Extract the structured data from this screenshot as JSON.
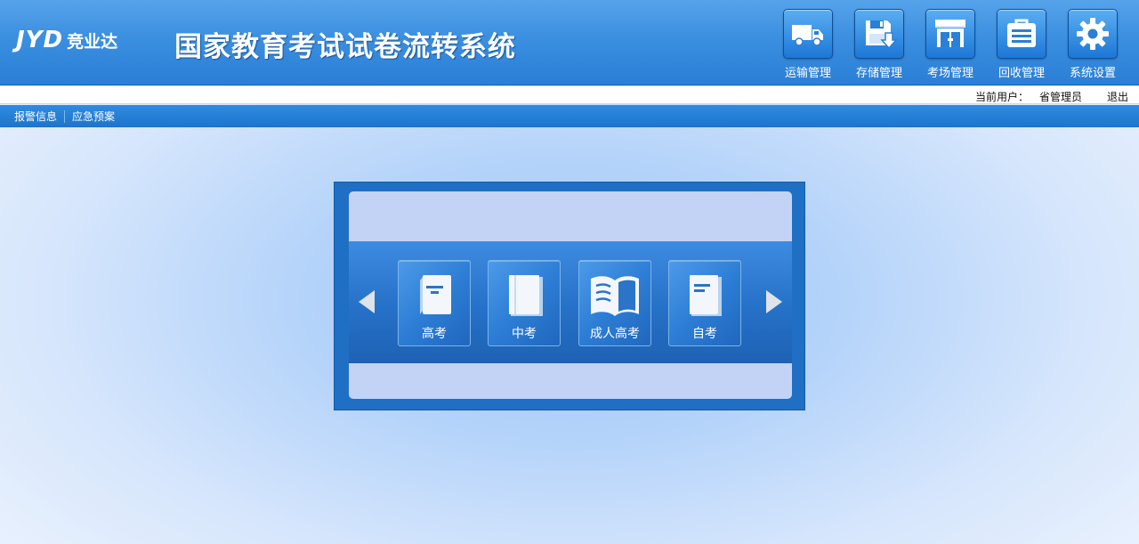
{
  "header": {
    "logo_mark": "JYD",
    "logo_cn": "竞业达",
    "title": "国家教育考试试卷流转系统"
  },
  "nav": [
    {
      "label": "运输管理",
      "icon": "truck-icon"
    },
    {
      "label": "存储管理",
      "icon": "floppy-download-icon"
    },
    {
      "label": "考场管理",
      "icon": "storefront-icon"
    },
    {
      "label": "回收管理",
      "icon": "briefcase-icon"
    },
    {
      "label": "系统设置",
      "icon": "gear-icon"
    }
  ],
  "userbar": {
    "user_label": "当前用户：",
    "user_name": "省管理员",
    "logout": "退出"
  },
  "submenu": [
    {
      "label": "报警信息"
    },
    {
      "label": "应急预案"
    }
  ],
  "exams": [
    {
      "label": "高考",
      "icon": "book-icon"
    },
    {
      "label": "中考",
      "icon": "book-closed-icon"
    },
    {
      "label": "成人高考",
      "icon": "book-open-icon"
    },
    {
      "label": "自考",
      "icon": "book-icon"
    }
  ],
  "colors": {
    "header_blue": "#3b8fe0",
    "panel_blue": "#1f6fc4",
    "panel_inner": "#c3d3f5"
  }
}
